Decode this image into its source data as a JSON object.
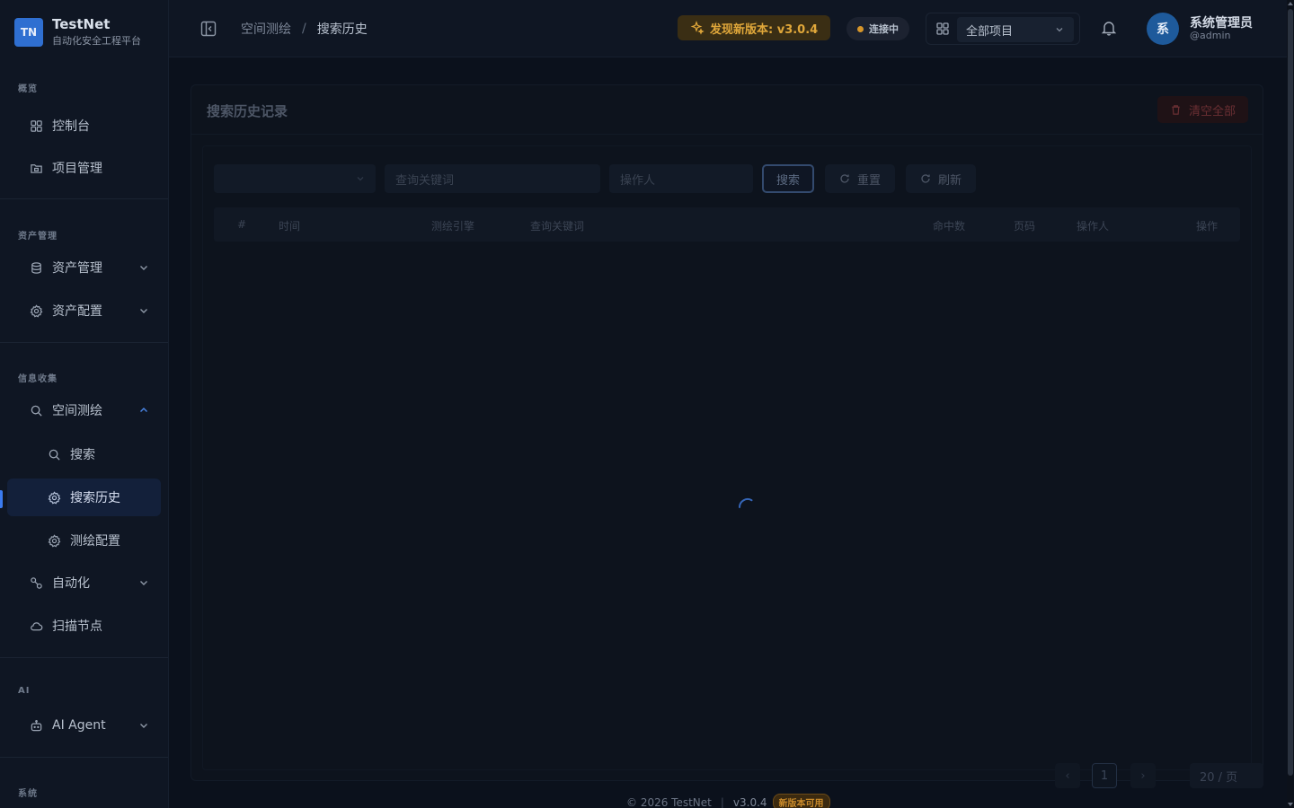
{
  "brand": {
    "logo": "TN",
    "name": "TestNet",
    "subtitle": "自动化安全工程平台"
  },
  "sidebar": {
    "sections": [
      {
        "title": "概览"
      },
      {
        "title": "资产管理"
      },
      {
        "title": "信息收集"
      },
      {
        "title": "AI"
      },
      {
        "title": "系统"
      }
    ],
    "items": [
      {
        "label": "控制台",
        "icon": "dashboard-icon"
      },
      {
        "label": "项目管理",
        "icon": "folder-icon"
      },
      {
        "label": "资产管理",
        "icon": "database-icon",
        "expandable": true
      },
      {
        "label": "资产配置",
        "icon": "gear-icon",
        "expandable": true
      },
      {
        "label": "空间测绘",
        "icon": "search-icon",
        "expanded": true
      },
      {
        "label": "搜索",
        "icon": "search-icon"
      },
      {
        "label": "搜索历史",
        "icon": "gear-icon",
        "active": true
      },
      {
        "label": "测绘配置",
        "icon": "gear-icon"
      },
      {
        "label": "自动化",
        "icon": "workflow-icon",
        "expandable": true
      },
      {
        "label": "扫描节点",
        "icon": "cloud-icon"
      },
      {
        "label": "AI Agent",
        "icon": "robot-icon",
        "expandable": true
      }
    ]
  },
  "header": {
    "breadcrumb": [
      "空间测绘",
      "搜索历史"
    ],
    "breadcrumb_separator": "/",
    "update_badge": "发现新版本: v3.0.4",
    "connection_status": "连接中",
    "project_select": "全部项目",
    "user": {
      "avatar": "系",
      "name": "系统管理员",
      "handle": "@admin"
    }
  },
  "card": {
    "title": "搜索历史记录",
    "clear_button": "清空全部",
    "filters": {
      "keyword_placeholder": "查询关键词",
      "operator_placeholder": "操作人",
      "search_button": "搜索",
      "reset_button": "重置",
      "refresh_button": "刷新"
    },
    "table_columns": [
      "#",
      "时间",
      "测绘引擎",
      "查询关键词",
      "命中数",
      "页码",
      "操作人",
      "操作"
    ],
    "pagination": {
      "page": "1",
      "page_size": "20 / 页"
    },
    "loading": true
  },
  "footer": {
    "copyright": "© 2026 TestNet",
    "version": "v3.0.4",
    "badge": "新版本可用"
  },
  "colors": {
    "accent": "#3b7bf0",
    "warning": "#e0a73a",
    "danger": "#6a2f33"
  }
}
